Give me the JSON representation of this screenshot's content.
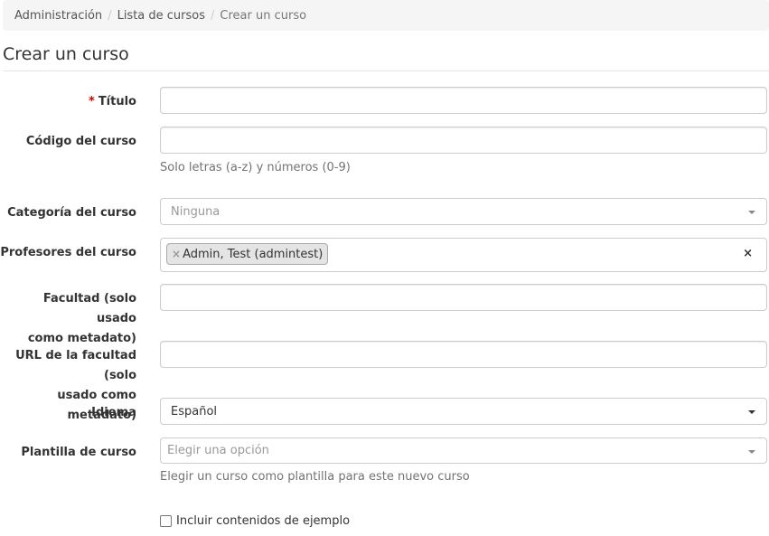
{
  "breadcrumb": {
    "items": [
      "Administración",
      "Lista de cursos",
      "Crear un curso"
    ],
    "separator": "/"
  },
  "page": {
    "title": "Crear un curso"
  },
  "form": {
    "titulo": {
      "required_mark": "*",
      "label": "Título",
      "value": ""
    },
    "codigo": {
      "label": "Código del curso",
      "value": "",
      "help": "Solo letras (a-z) y números (0-9)"
    },
    "categoria": {
      "label": "Categoría del curso",
      "placeholder": "Ninguna"
    },
    "profesores": {
      "label": "Profesores del curso",
      "tag_remove": "×",
      "tags": [
        "Admin, Test (admintest)"
      ],
      "clear": "×"
    },
    "facultad": {
      "label_line1": "Facultad (solo usado",
      "label_line2": "como metadato)",
      "value": ""
    },
    "url_facultad": {
      "label_line1": "URL de la facultad (solo",
      "label_line2": "usado como metadato)",
      "value": ""
    },
    "idioma": {
      "label": "Idioma",
      "value": "Español"
    },
    "plantilla": {
      "label": "Plantilla de curso",
      "placeholder": "Elegir una opción",
      "help": "Elegir un curso como plantilla para este nuevo curso"
    },
    "ejemplo": {
      "label": "Incluir contenidos de ejemplo",
      "checked": false
    }
  }
}
